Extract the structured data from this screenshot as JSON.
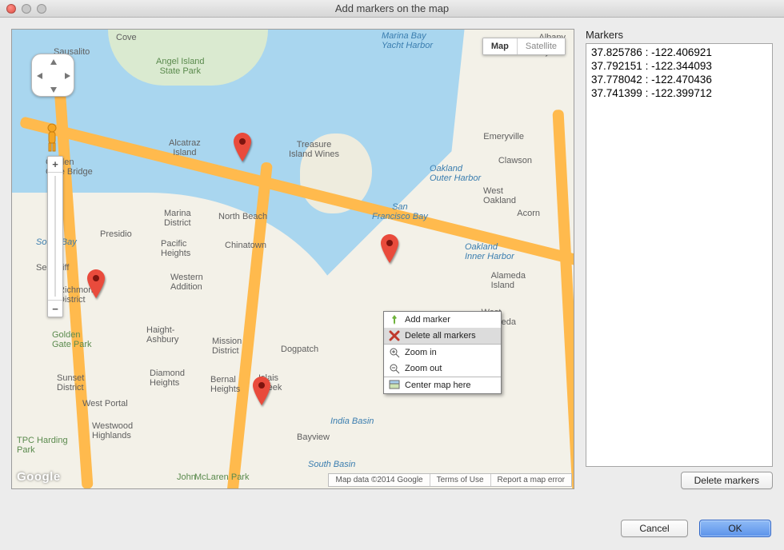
{
  "window": {
    "title": "Add markers on the map"
  },
  "mapTypes": {
    "map": "Map",
    "satellite": "Satellite"
  },
  "places": {
    "sausalito": "Sausalito",
    "cove": "Cove",
    "yacht": "Marina Bay\nYacht Harbor",
    "berkeley": "Berkeley",
    "angel": "Angel Island\nState Park",
    "albany": "Albany",
    "alcatraz": "Alcatraz\nIsland",
    "treasure": "Treasure\nIsland Wines",
    "ggb": "Golden\nGate Bridge",
    "emery": "Emeryville",
    "clawson": "Clawson",
    "oakOuter": "Oakland\nOuter Harbor",
    "westOak": "West\nOakland",
    "acorn": "Acorn",
    "sfbay": "San\nFrancisco Bay",
    "marina": "Marina\nDistrict",
    "northb": "North Beach",
    "presidio": "Presidio",
    "pacH": "Pacific\nHeights",
    "china": "Chinatown",
    "seacliff": "Sea Cliff",
    "oakInner": "Oakland\nInner Harbor",
    "alamedaI": "Alameda\nIsland",
    "richmond": "Richmond\nDistrict",
    "westAdd": "Western\nAddition",
    "westAl": "West\nAlameda",
    "southB": "South Bay",
    "haight": "Haight-\nAshbury",
    "missionD": "Mission\nDistrict",
    "dogpatch": "Dogpatch",
    "ggp": "Golden\nGate Park",
    "sunset": "Sunset\nDistrict",
    "diamond": "Diamond\nHeights",
    "bernal": "Bernal\nHeights",
    "islais": "Islais\nCreek",
    "westP": "West Portal",
    "westwood": "Westwood\nHighlands",
    "bayview": "Bayview",
    "indiaB": "India Basin",
    "southBasin": "South Basin",
    "harding": "TPC Harding\nPark",
    "mclaren": "McLaren Park",
    "john": "John"
  },
  "context": {
    "add": "Add marker",
    "delAll": "Delete all markers",
    "zin": "Zoom in",
    "zout": "Zoom out",
    "center": "Center map here"
  },
  "credits": {
    "data": "Map data ©2014 Google",
    "terms": "Terms of Use",
    "report": "Report a map error"
  },
  "side": {
    "title": "Markers",
    "rows": [
      {
        "lat": "37.825786",
        "lon": "-122.406921"
      },
      {
        "lat": "37.792151",
        "lon": "-122.344093"
      },
      {
        "lat": "37.778042",
        "lon": "-122.470436"
      },
      {
        "lat": "37.741399",
        "lon": "-122.399712"
      }
    ]
  },
  "buttons": {
    "deleteMarkers": "Delete markers",
    "cancel": "Cancel",
    "ok": "OK"
  },
  "googleLogo": "Google"
}
